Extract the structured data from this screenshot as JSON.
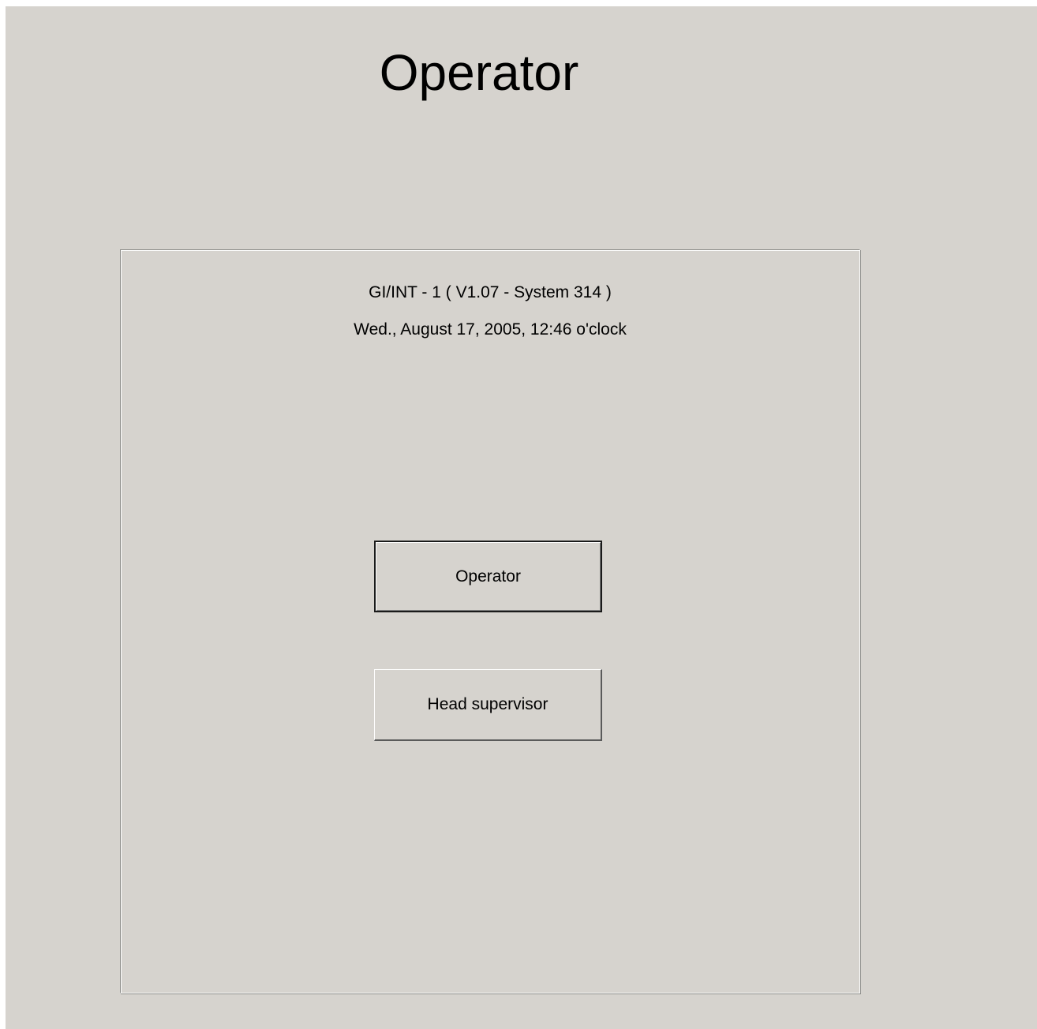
{
  "header": {
    "title": "Operator"
  },
  "panel": {
    "version_text": "GI/INT - 1 ( V1.07 - System 314 )",
    "datetime_text": "Wed., August 17, 2005, 12:46 o'clock"
  },
  "buttons": {
    "operator_label": "Operator",
    "head_supervisor_label": "Head supervisor"
  },
  "colors": {
    "background": "#d6d3ce",
    "text": "#000000"
  }
}
